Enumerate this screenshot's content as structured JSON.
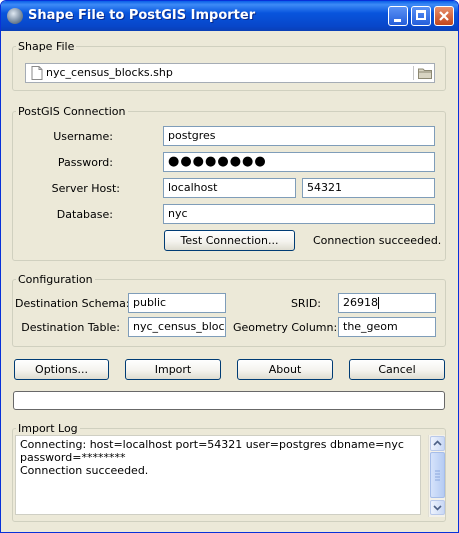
{
  "window": {
    "title": "Shape File to PostGIS Importer",
    "icon": "postgis-elephant-icon"
  },
  "shape_file": {
    "legend": "Shape File",
    "file_name": "nyc_census_blocks.shp",
    "file_icon": "document-icon",
    "browse_icon": "folder-icon"
  },
  "connection": {
    "legend": "PostGIS Connection",
    "username_label": "Username:",
    "username": "postgres",
    "password_label": "Password:",
    "password_masked": "●●●●●●●●",
    "host_label": "Server Host:",
    "host": "localhost",
    "port": "54321",
    "database_label": "Database:",
    "database": "nyc",
    "test_button": "Test Connection...",
    "status": "Connection succeeded."
  },
  "configuration": {
    "legend": "Configuration",
    "schema_label": "Destination Schema:",
    "schema": "public",
    "srid_label": "SRID:",
    "srid": "26918",
    "table_label": "Destination Table:",
    "table": "nyc_census_blocks",
    "geom_label": "Geometry Column:",
    "geom": "the_geom"
  },
  "actions": {
    "options": "Options...",
    "import": "Import",
    "about": "About",
    "cancel": "Cancel"
  },
  "progress": {
    "fraction": 0
  },
  "log": {
    "legend": "Import Log",
    "lines": [
      "Connecting:  host=localhost port=54321 user=postgres dbname=nyc",
      "password=********",
      "Connection succeeded."
    ]
  }
}
